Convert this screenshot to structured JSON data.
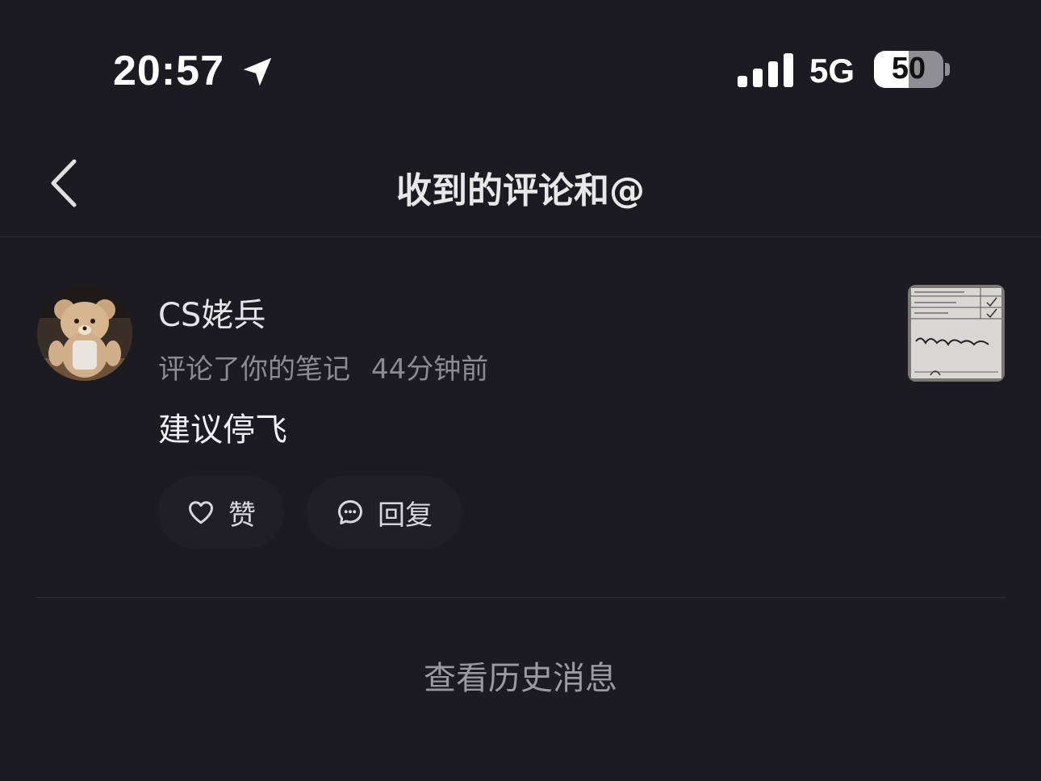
{
  "status_bar": {
    "time": "20:57",
    "network": "5G",
    "battery_level": "50",
    "battery_fraction": 0.5,
    "location_icon": "location-arrow-icon",
    "signal_icon": "signal-bars-icon"
  },
  "nav": {
    "back_icon": "chevron-left-icon",
    "title": "收到的评论和@"
  },
  "comment": {
    "username": "CS姥兵",
    "action_text": "评论了你的笔记",
    "time_ago": "44分钟前",
    "text": "建议停飞",
    "like_label": "赞",
    "reply_label": "回复",
    "like_icon": "heart-icon",
    "reply_icon": "chat-bubble-icon"
  },
  "footer": {
    "history_label": "查看历史消息"
  },
  "colors": {
    "background": "#1b1b21",
    "divider": "#2c2c33",
    "secondary_text": "#8b8b91",
    "button_bg": "#1f1f25"
  }
}
